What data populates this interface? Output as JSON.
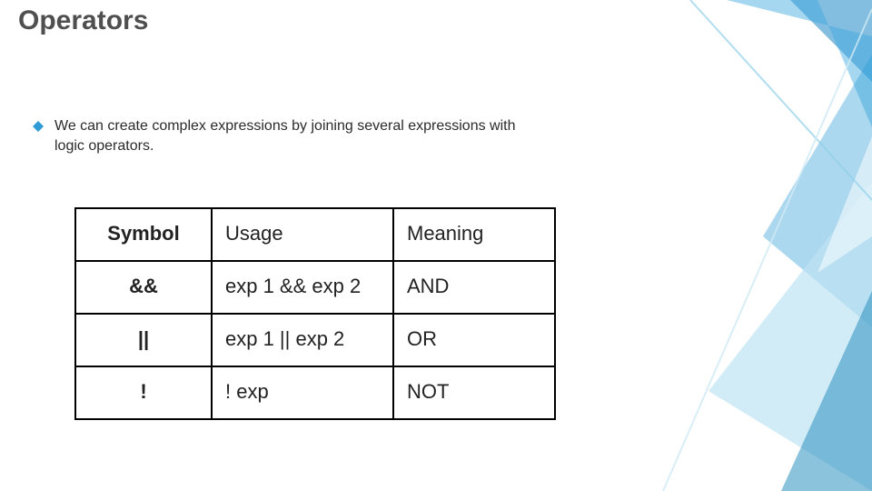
{
  "title": "Operators",
  "bullet": "We can create complex expressions by joining several expressions with logic operators.",
  "table": {
    "headers": [
      "Symbol",
      "Usage",
      "Meaning"
    ],
    "rows": [
      {
        "symbol": "&&",
        "usage": "exp 1 && exp 2",
        "meaning": "AND"
      },
      {
        "symbol": "||",
        "usage": "exp 1 || exp 2",
        "meaning": "OR"
      },
      {
        "symbol": "!",
        "usage": "! exp",
        "meaning": "NOT"
      }
    ]
  }
}
